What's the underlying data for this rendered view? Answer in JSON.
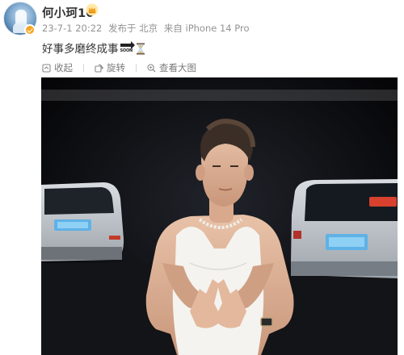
{
  "post": {
    "author": "何小珂10",
    "date": "23-7-1 20:22",
    "location": "发布于 北京",
    "source": "来自 iPhone 14 Pro",
    "text": "好事多磨终成事",
    "soon_label": "SOON"
  },
  "toolbar": {
    "collapse_label": "收起",
    "rotate_label": "旋转",
    "view_large_label": "查看大图"
  },
  "icons": {
    "author_badge": "crown-icon",
    "verified": "verified-badge-icon",
    "emoji_1": "soon-arrow-emoji",
    "emoji_2": "hourglass-emoji",
    "collapse": "collapse-icon",
    "rotate": "rotate-icon",
    "view_large": "zoom-icon"
  },
  "colors": {
    "text_primary": "#333333",
    "text_meta": "#939393",
    "verified_badge": "#f5a623"
  }
}
